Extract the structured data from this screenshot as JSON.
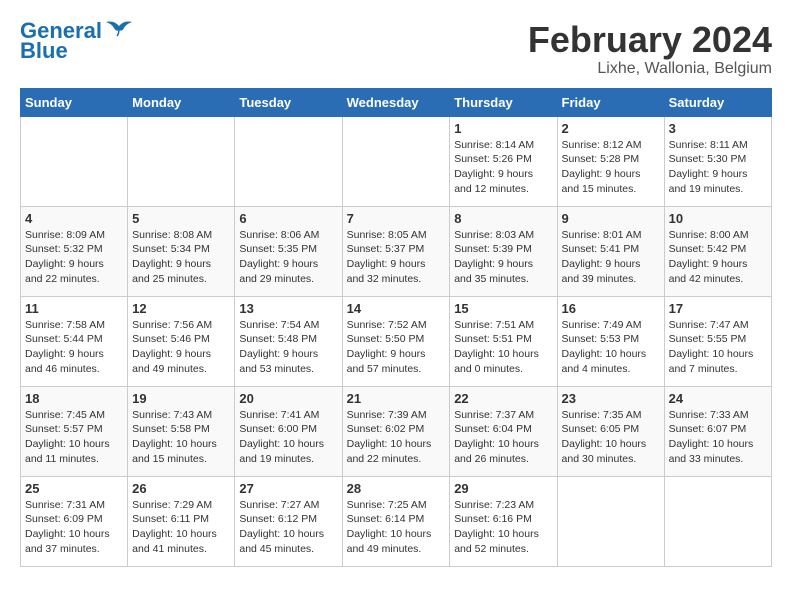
{
  "logo": {
    "line1": "General",
    "line2": "Blue"
  },
  "title": "February 2024",
  "subtitle": "Lixhe, Wallonia, Belgium",
  "days_of_week": [
    "Sunday",
    "Monday",
    "Tuesday",
    "Wednesday",
    "Thursday",
    "Friday",
    "Saturday"
  ],
  "weeks": [
    [
      {
        "day": "",
        "info": ""
      },
      {
        "day": "",
        "info": ""
      },
      {
        "day": "",
        "info": ""
      },
      {
        "day": "",
        "info": ""
      },
      {
        "day": "1",
        "info": "Sunrise: 8:14 AM\nSunset: 5:26 PM\nDaylight: 9 hours\nand 12 minutes."
      },
      {
        "day": "2",
        "info": "Sunrise: 8:12 AM\nSunset: 5:28 PM\nDaylight: 9 hours\nand 15 minutes."
      },
      {
        "day": "3",
        "info": "Sunrise: 8:11 AM\nSunset: 5:30 PM\nDaylight: 9 hours\nand 19 minutes."
      }
    ],
    [
      {
        "day": "4",
        "info": "Sunrise: 8:09 AM\nSunset: 5:32 PM\nDaylight: 9 hours\nand 22 minutes."
      },
      {
        "day": "5",
        "info": "Sunrise: 8:08 AM\nSunset: 5:34 PM\nDaylight: 9 hours\nand 25 minutes."
      },
      {
        "day": "6",
        "info": "Sunrise: 8:06 AM\nSunset: 5:35 PM\nDaylight: 9 hours\nand 29 minutes."
      },
      {
        "day": "7",
        "info": "Sunrise: 8:05 AM\nSunset: 5:37 PM\nDaylight: 9 hours\nand 32 minutes."
      },
      {
        "day": "8",
        "info": "Sunrise: 8:03 AM\nSunset: 5:39 PM\nDaylight: 9 hours\nand 35 minutes."
      },
      {
        "day": "9",
        "info": "Sunrise: 8:01 AM\nSunset: 5:41 PM\nDaylight: 9 hours\nand 39 minutes."
      },
      {
        "day": "10",
        "info": "Sunrise: 8:00 AM\nSunset: 5:42 PM\nDaylight: 9 hours\nand 42 minutes."
      }
    ],
    [
      {
        "day": "11",
        "info": "Sunrise: 7:58 AM\nSunset: 5:44 PM\nDaylight: 9 hours\nand 46 minutes."
      },
      {
        "day": "12",
        "info": "Sunrise: 7:56 AM\nSunset: 5:46 PM\nDaylight: 9 hours\nand 49 minutes."
      },
      {
        "day": "13",
        "info": "Sunrise: 7:54 AM\nSunset: 5:48 PM\nDaylight: 9 hours\nand 53 minutes."
      },
      {
        "day": "14",
        "info": "Sunrise: 7:52 AM\nSunset: 5:50 PM\nDaylight: 9 hours\nand 57 minutes."
      },
      {
        "day": "15",
        "info": "Sunrise: 7:51 AM\nSunset: 5:51 PM\nDaylight: 10 hours\nand 0 minutes."
      },
      {
        "day": "16",
        "info": "Sunrise: 7:49 AM\nSunset: 5:53 PM\nDaylight: 10 hours\nand 4 minutes."
      },
      {
        "day": "17",
        "info": "Sunrise: 7:47 AM\nSunset: 5:55 PM\nDaylight: 10 hours\nand 7 minutes."
      }
    ],
    [
      {
        "day": "18",
        "info": "Sunrise: 7:45 AM\nSunset: 5:57 PM\nDaylight: 10 hours\nand 11 minutes."
      },
      {
        "day": "19",
        "info": "Sunrise: 7:43 AM\nSunset: 5:58 PM\nDaylight: 10 hours\nand 15 minutes."
      },
      {
        "day": "20",
        "info": "Sunrise: 7:41 AM\nSunset: 6:00 PM\nDaylight: 10 hours\nand 19 minutes."
      },
      {
        "day": "21",
        "info": "Sunrise: 7:39 AM\nSunset: 6:02 PM\nDaylight: 10 hours\nand 22 minutes."
      },
      {
        "day": "22",
        "info": "Sunrise: 7:37 AM\nSunset: 6:04 PM\nDaylight: 10 hours\nand 26 minutes."
      },
      {
        "day": "23",
        "info": "Sunrise: 7:35 AM\nSunset: 6:05 PM\nDaylight: 10 hours\nand 30 minutes."
      },
      {
        "day": "24",
        "info": "Sunrise: 7:33 AM\nSunset: 6:07 PM\nDaylight: 10 hours\nand 33 minutes."
      }
    ],
    [
      {
        "day": "25",
        "info": "Sunrise: 7:31 AM\nSunset: 6:09 PM\nDaylight: 10 hours\nand 37 minutes."
      },
      {
        "day": "26",
        "info": "Sunrise: 7:29 AM\nSunset: 6:11 PM\nDaylight: 10 hours\nand 41 minutes."
      },
      {
        "day": "27",
        "info": "Sunrise: 7:27 AM\nSunset: 6:12 PM\nDaylight: 10 hours\nand 45 minutes."
      },
      {
        "day": "28",
        "info": "Sunrise: 7:25 AM\nSunset: 6:14 PM\nDaylight: 10 hours\nand 49 minutes."
      },
      {
        "day": "29",
        "info": "Sunrise: 7:23 AM\nSunset: 6:16 PM\nDaylight: 10 hours\nand 52 minutes."
      },
      {
        "day": "",
        "info": ""
      },
      {
        "day": "",
        "info": ""
      }
    ]
  ]
}
